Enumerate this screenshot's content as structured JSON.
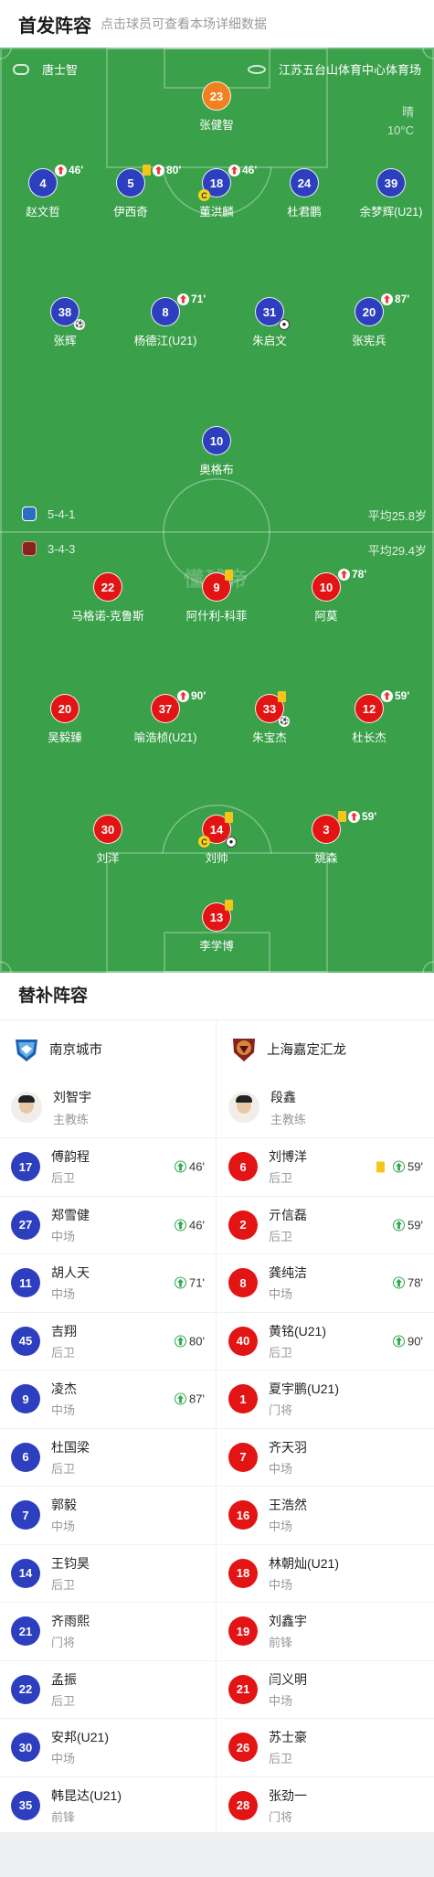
{
  "header": {
    "title": "首发阵容",
    "subtitle": "点击球员可查看本场详细数据"
  },
  "match": {
    "referee": "唐士智",
    "venue": "江苏五台山体育中心体育场",
    "weather": "晴",
    "temperature": "10°C"
  },
  "watermark": "懂球帝",
  "home_team": {
    "name": "南京城市",
    "formation": "5-4-1",
    "avg_age": "平均25.8岁",
    "color": "#2d3fbf"
  },
  "away_team": {
    "name": "上海嘉定汇龙",
    "formation": "3-4-3",
    "avg_age": "平均29.4岁",
    "color": "#e31414"
  },
  "home_lineup": [
    {
      "number": "23",
      "name": "张健智",
      "role": "gk"
    },
    {
      "number": "4",
      "name": "赵文哲",
      "sub_out": "46'"
    },
    {
      "number": "5",
      "name": "伊西奇",
      "yellow": true,
      "sub_out": "80'"
    },
    {
      "number": "18",
      "name": "董洪麟",
      "captain": true,
      "sub_out": "46'"
    },
    {
      "number": "24",
      "name": "杜君鹏"
    },
    {
      "number": "39",
      "name": "余梦辉(U21)"
    },
    {
      "number": "38",
      "name": "张辉",
      "assist": true
    },
    {
      "number": "8",
      "name": "杨德江(U21)",
      "sub_out": "71'"
    },
    {
      "number": "31",
      "name": "朱启文",
      "goal": true
    },
    {
      "number": "20",
      "name": "张宪兵",
      "sub_out": "87'"
    },
    {
      "number": "10",
      "name": "奥格布"
    }
  ],
  "away_lineup": [
    {
      "number": "22",
      "name": "马格诺-克鲁斯"
    },
    {
      "number": "9",
      "name": "阿什利-科菲",
      "yellow": true
    },
    {
      "number": "10",
      "name": "阿莫",
      "sub_out": "78'"
    },
    {
      "number": "20",
      "name": "吴毅臻"
    },
    {
      "number": "37",
      "name": "喻浩桢(U21)",
      "sub_out": "90'"
    },
    {
      "number": "33",
      "name": "朱宝杰",
      "yellow": true,
      "assist": true
    },
    {
      "number": "12",
      "name": "杜长杰",
      "sub_out": "59'"
    },
    {
      "number": "30",
      "name": "刘洋"
    },
    {
      "number": "14",
      "name": "刘帅",
      "yellow": true,
      "captain": true,
      "goal": true
    },
    {
      "number": "3",
      "name": "姚森",
      "yellow": true,
      "sub_out": "59'"
    },
    {
      "number": "13",
      "name": "李学博",
      "role": "gk",
      "yellow": true
    }
  ],
  "subs_section": {
    "title": "替补阵容",
    "coach_role": "主教练"
  },
  "home_subs": {
    "coach": "刘智宇",
    "players": [
      {
        "number": "17",
        "name": "傅韵程",
        "position": "后卫",
        "in": "46'"
      },
      {
        "number": "27",
        "name": "郑雪健",
        "position": "中场",
        "in": "46'"
      },
      {
        "number": "11",
        "name": "胡人天",
        "position": "中场",
        "in": "71'"
      },
      {
        "number": "45",
        "name": "吉翔",
        "position": "后卫",
        "in": "80'"
      },
      {
        "number": "9",
        "name": "凌杰",
        "position": "中场",
        "in": "87'"
      },
      {
        "number": "6",
        "name": "杜国梁",
        "position": "后卫"
      },
      {
        "number": "7",
        "name": "郭毅",
        "position": "中场"
      },
      {
        "number": "14",
        "name": "王钧昊",
        "position": "后卫"
      },
      {
        "number": "21",
        "name": "齐雨熙",
        "position": "门将"
      },
      {
        "number": "22",
        "name": "孟振",
        "position": "后卫"
      },
      {
        "number": "30",
        "name": "安邦(U21)",
        "position": "中场"
      },
      {
        "number": "35",
        "name": "韩昆达(U21)",
        "position": "前锋"
      }
    ]
  },
  "away_subs": {
    "coach": "段鑫",
    "players": [
      {
        "number": "6",
        "name": "刘博洋",
        "position": "后卫",
        "in": "59'",
        "yellow": true
      },
      {
        "number": "2",
        "name": "亓信磊",
        "position": "后卫",
        "in": "59'"
      },
      {
        "number": "8",
        "name": "龚纯洁",
        "position": "中场",
        "in": "78'"
      },
      {
        "number": "40",
        "name": "黄铭(U21)",
        "position": "后卫",
        "in": "90'"
      },
      {
        "number": "1",
        "name": "夏宇鹏(U21)",
        "position": "门将"
      },
      {
        "number": "7",
        "name": "齐天羽",
        "position": "中场"
      },
      {
        "number": "16",
        "name": "王浩然",
        "position": "中场"
      },
      {
        "number": "18",
        "name": "林朝灿(U21)",
        "position": "中场"
      },
      {
        "number": "19",
        "name": "刘鑫宇",
        "position": "前锋"
      },
      {
        "number": "21",
        "name": "闫义明",
        "position": "中场"
      },
      {
        "number": "26",
        "name": "苏士豪",
        "position": "后卫"
      },
      {
        "number": "28",
        "name": "张劲一",
        "position": "门将"
      }
    ]
  }
}
